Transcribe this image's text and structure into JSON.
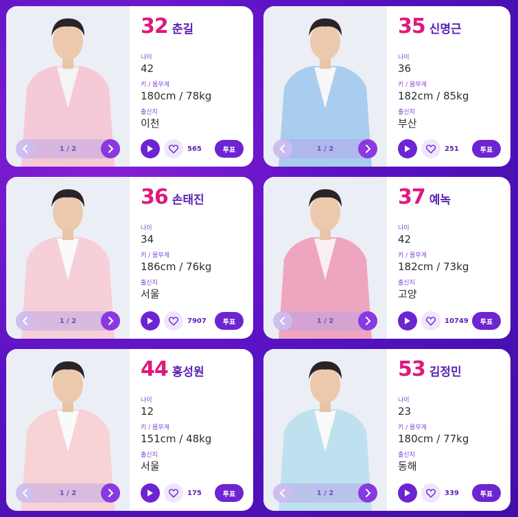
{
  "labels": {
    "age": "나이",
    "height_weight": "키 / 몸무게",
    "hometown": "출신지",
    "vote": "투표"
  },
  "colors": {
    "accent_number": "#e0197d",
    "name": "#5a1fb0",
    "button": "#6d24d1"
  },
  "cards": [
    {
      "number": "32",
      "name": "춘길",
      "age": "42",
      "hw": "180cm / 78kg",
      "hometown": "이천",
      "page": "1 / 2",
      "likes": "565",
      "suit": "#f6c9d6",
      "shirt": "#f4f4f4"
    },
    {
      "number": "35",
      "name": "신명근",
      "age": "36",
      "hw": "182cm / 85kg",
      "hometown": "부산",
      "page": "1 / 2",
      "likes": "251",
      "suit": "#a9cdef",
      "shirt": "#f7f7f7"
    },
    {
      "number": "36",
      "name": "손태진",
      "age": "34",
      "hw": "186cm / 76kg",
      "hometown": "서울",
      "page": "1 / 2",
      "likes": "7907",
      "suit": "#f6cfd8",
      "shirt": "#fafafa"
    },
    {
      "number": "37",
      "name": "예녹",
      "age": "42",
      "hw": "182cm / 73kg",
      "hometown": "고양",
      "page": "1 / 2",
      "likes": "10749",
      "suit": "#eea6c0",
      "shirt": "#fbeef3"
    },
    {
      "number": "44",
      "name": "홍성원",
      "age": "12",
      "hw": "151cm / 48kg",
      "hometown": "서울",
      "page": "1 / 2",
      "likes": "175",
      "suit": "#f7d3d6",
      "shirt": "#fafafa"
    },
    {
      "number": "53",
      "name": "김정민",
      "age": "23",
      "hw": "180cm / 77kg",
      "hometown": "동해",
      "page": "1 / 2",
      "likes": "339",
      "suit": "#bfe1ef",
      "shirt": "#f9f9f9"
    }
  ]
}
